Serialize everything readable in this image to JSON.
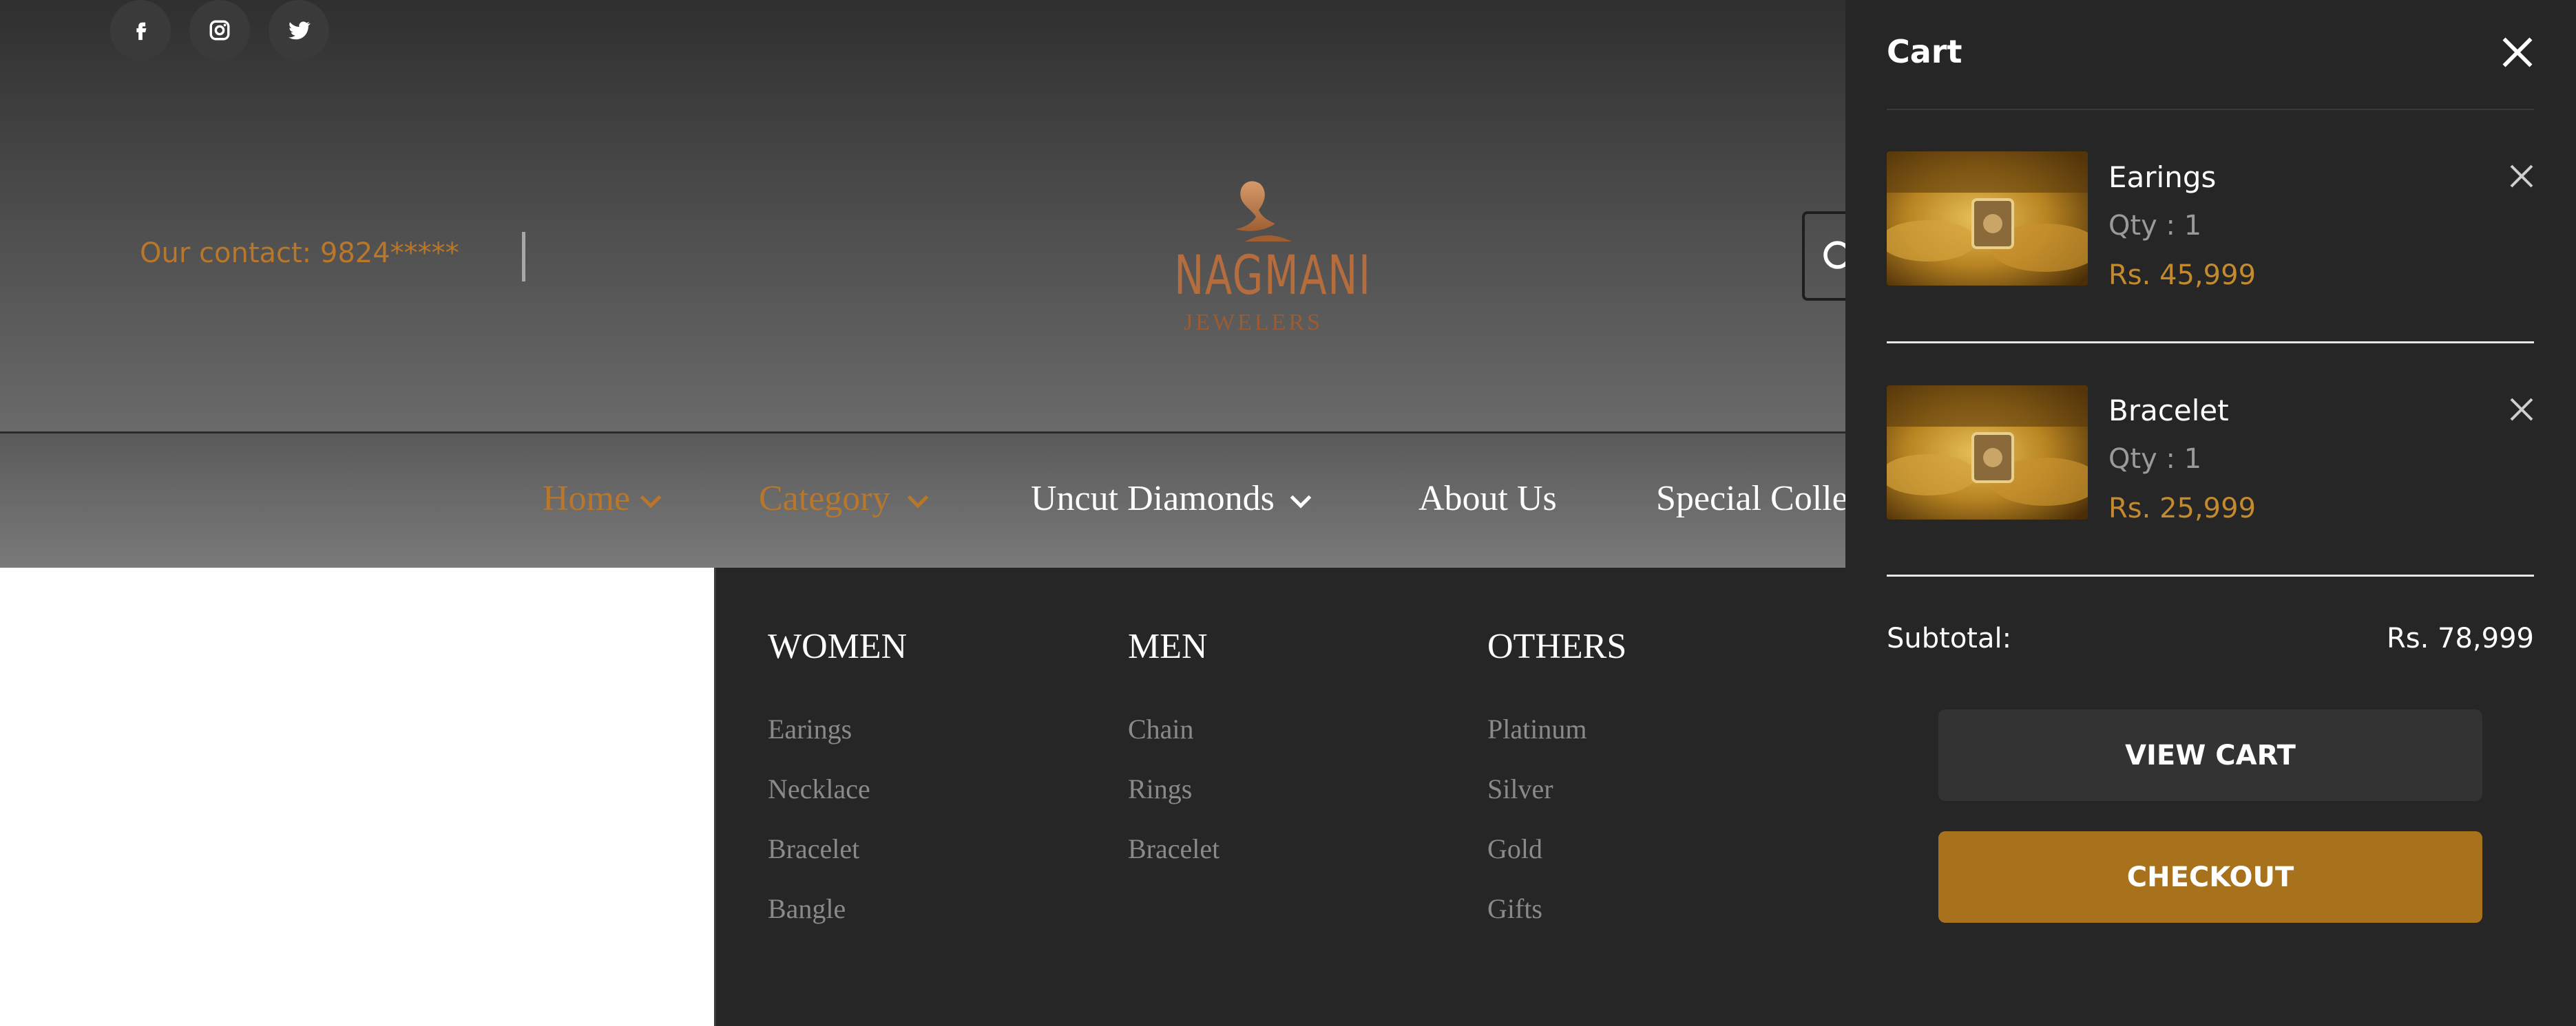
{
  "social": {
    "icons": [
      "facebook-icon",
      "instagram-icon",
      "twitter-icon"
    ]
  },
  "header": {
    "contact": "Our contact: 9824*****",
    "logo": {
      "name": "NAGMANI",
      "tagline": "JEWELERS"
    }
  },
  "nav": {
    "items": [
      {
        "label": "Home",
        "has_dropdown": true,
        "active": true
      },
      {
        "label": "Category",
        "has_dropdown": true,
        "active": true
      },
      {
        "label": "Uncut Diamonds",
        "has_dropdown": true,
        "active": false
      },
      {
        "label": "About Us",
        "has_dropdown": false,
        "active": false
      },
      {
        "label": "Special Colle",
        "has_dropdown": false,
        "active": false
      }
    ]
  },
  "mega_menu": {
    "columns": [
      {
        "title": "WOMEN",
        "links": [
          "Earings",
          "Necklace",
          "Bracelet",
          "Bangle"
        ]
      },
      {
        "title": "MEN",
        "links": [
          "Chain",
          "Rings",
          "Bracelet"
        ]
      },
      {
        "title": "OTHERS",
        "links": [
          "Platinum",
          "Silver",
          "Gold",
          "Gifts"
        ]
      }
    ]
  },
  "cart": {
    "title": "Cart",
    "items": [
      {
        "name": "Earings",
        "qty": "Qty : 1",
        "price": "Rs. 45,999"
      },
      {
        "name": "Bracelet",
        "qty": "Qty : 1",
        "price": "Rs. 25,999"
      }
    ],
    "subtotal_label": "Subtotal:",
    "subtotal_value": "Rs. 78,999",
    "view_cart_label": "VIEW CART",
    "checkout_label": "CHECKOUT"
  },
  "colors": {
    "accent": "#c48a2e",
    "checkout_button": "#a8721c",
    "panel_bg": "#262626",
    "view_cart_button": "#333333"
  }
}
